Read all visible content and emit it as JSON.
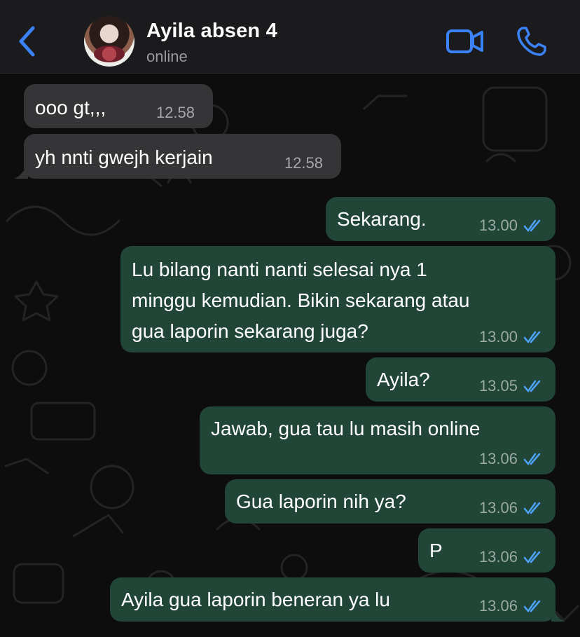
{
  "header": {
    "contact_name": "Ayila absen 4",
    "status": "online"
  },
  "colors": {
    "accent": "#3b82f6",
    "incoming_bubble": "#353537",
    "outgoing_bubble": "#214638",
    "tick": "#4ea3ff"
  },
  "messages": [
    {
      "direction": "incoming",
      "text": "ooo gt,,,",
      "time": "12.58"
    },
    {
      "direction": "incoming",
      "text": "yh nnti gwejh kerjain",
      "time": "12.58"
    },
    {
      "direction": "outgoing",
      "text": "Sekarang.",
      "time": "13.00",
      "status": "read"
    },
    {
      "direction": "outgoing",
      "text": "Lu bilang nanti nanti selesai nya 1\nminggu kemudian. Bikin sekarang atau\ngua laporin sekarang juga?",
      "time": "13.00",
      "status": "read"
    },
    {
      "direction": "outgoing",
      "text": "Ayila?",
      "time": "13.05",
      "status": "read"
    },
    {
      "direction": "outgoing",
      "text": "Jawab, gua tau lu masih online",
      "time": "13.06",
      "status": "read"
    },
    {
      "direction": "outgoing",
      "text": "Gua laporin nih ya?",
      "time": "13.06",
      "status": "read"
    },
    {
      "direction": "outgoing",
      "text": "P",
      "time": "13.06",
      "status": "read"
    },
    {
      "direction": "outgoing",
      "text": "Ayila gua laporin beneran ya lu",
      "time": "13.06",
      "status": "read"
    }
  ]
}
